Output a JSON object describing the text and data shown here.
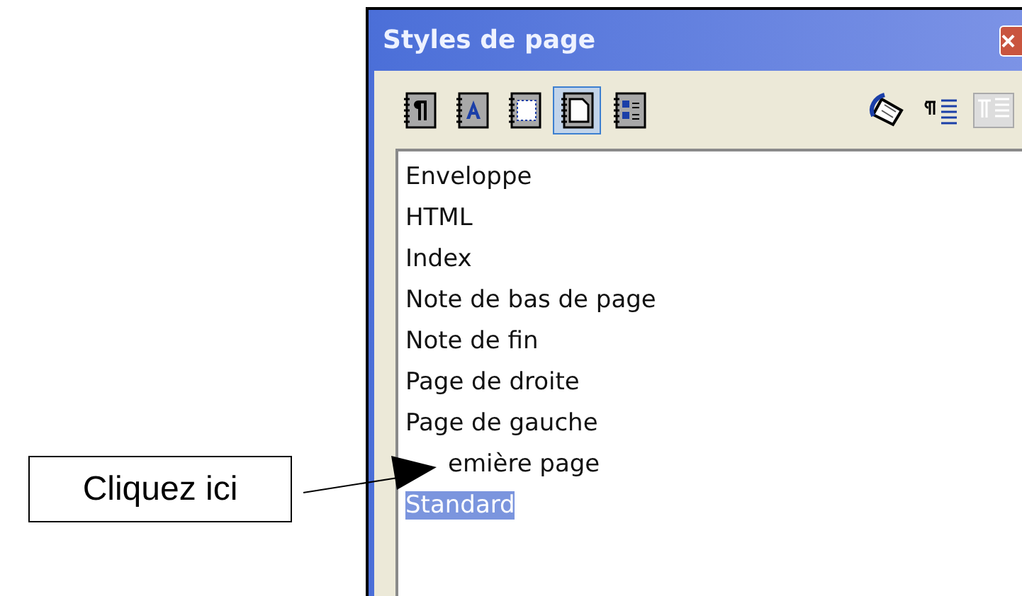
{
  "callout": {
    "label": "Cliquez ici"
  },
  "window": {
    "title": "Styles de page",
    "close": "×"
  },
  "toolbar": {
    "families": [
      {
        "kind": "paragraph",
        "selected": false
      },
      {
        "kind": "character",
        "selected": false
      },
      {
        "kind": "frame",
        "selected": false
      },
      {
        "kind": "page",
        "selected": true
      },
      {
        "kind": "list",
        "selected": false
      }
    ],
    "actions": [
      {
        "kind": "fill",
        "disabled": false
      },
      {
        "kind": "new",
        "disabled": false
      },
      {
        "kind": "update",
        "disabled": true
      }
    ]
  },
  "styles": [
    {
      "label": "Enveloppe",
      "selected": false
    },
    {
      "label": "HTML",
      "selected": false
    },
    {
      "label": "Index",
      "selected": false
    },
    {
      "label": "Note de bas de page",
      "selected": false
    },
    {
      "label": "Note de fin",
      "selected": false
    },
    {
      "label": "Page de droite",
      "selected": false
    },
    {
      "label": "Page de gauche",
      "selected": false
    },
    {
      "label": "emière page",
      "selected": false,
      "covered": true
    },
    {
      "label": "Standard",
      "selected": true
    }
  ]
}
